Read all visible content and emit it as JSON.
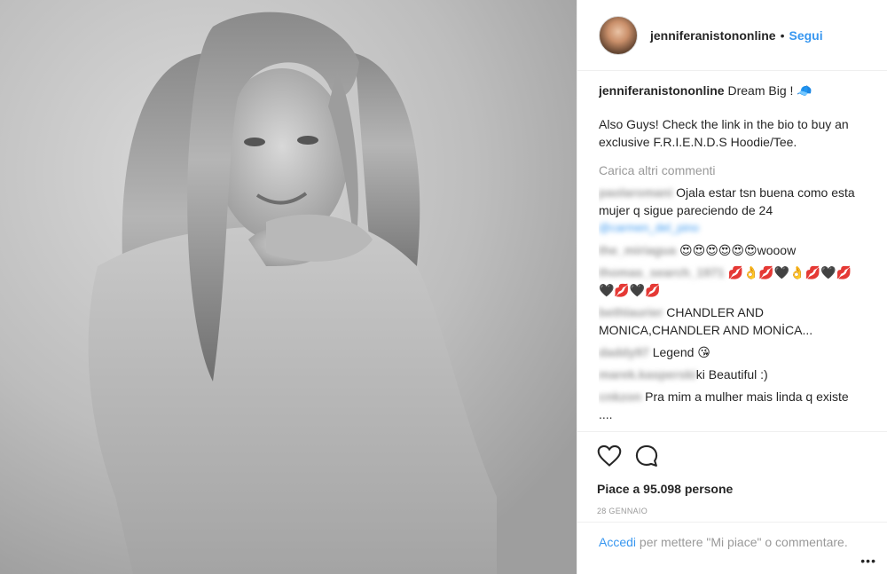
{
  "header": {
    "username": "jenniferanistononline",
    "separator": "•",
    "follow_label": "Segui"
  },
  "caption": {
    "username": "jenniferanistononline",
    "line1": " Dream Big ! 🧢",
    "line2": "Also Guys! Check the link in the bio to buy an exclusive F.R.I.E.N.D.S Hoodie/Tee."
  },
  "load_more_label": "Carica altri commenti",
  "comments": [
    {
      "user": "paolaromani",
      "text": " Ojala estar tsn buena como esta mujer q sigue pareciendo de 24",
      "mention": "@carmen_del_pino"
    },
    {
      "user": "the_miriagua",
      "text": " 😍😍😍😍😍😍wooow"
    },
    {
      "user": "thomas_search_1971",
      "text": " 💋👌💋🖤👌💋🖤💋 🖤💋🖤💋"
    },
    {
      "user": "bethlaurier",
      "text": " CHANDLER AND MONICA,CHANDLER AND MONİCA..."
    },
    {
      "user": "daddy97",
      "text": " Legend 😘"
    },
    {
      "user": "marek.kasperski",
      "text": "ki Beautiful :)"
    },
    {
      "user": "cnkzon",
      "text": " Pra mim a mulher mais linda q existe ...."
    }
  ],
  "likes_text": "Piace a 95.098 persone",
  "date": "28 GENNAIO",
  "login": {
    "link": "Accedi",
    "text": " per mettere \"Mi piace\" o commentare."
  },
  "more_label": "•••",
  "icons": {
    "like": "heart-icon",
    "comment": "comment-bubble-icon"
  }
}
